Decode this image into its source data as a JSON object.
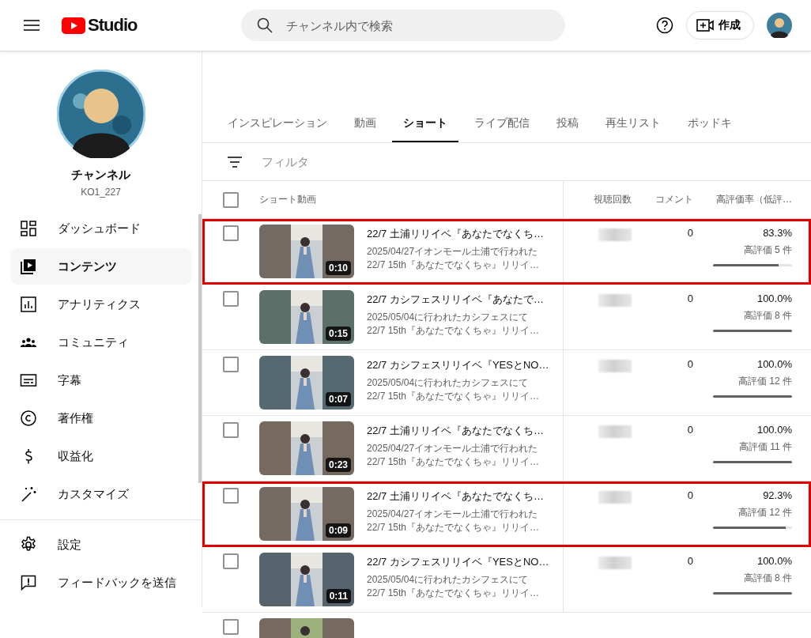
{
  "header": {
    "logo_text": "Studio",
    "search": {
      "placeholder": "チャンネル内で検索"
    },
    "create_button": "作成"
  },
  "channel": {
    "name": "チャンネル",
    "handle": "KO1_227"
  },
  "sidebar": {
    "items": [
      {
        "label": "ダッシュボード",
        "selected": false
      },
      {
        "label": "コンテンツ",
        "selected": true
      },
      {
        "label": "アナリティクス",
        "selected": false
      },
      {
        "label": "コミュニティ",
        "selected": false
      },
      {
        "label": "字幕",
        "selected": false
      },
      {
        "label": "著作権",
        "selected": false
      },
      {
        "label": "収益化",
        "selected": false
      },
      {
        "label": "カスタマイズ",
        "selected": false
      }
    ],
    "footer_items": [
      {
        "label": "設定"
      },
      {
        "label": "フィードバックを送信"
      }
    ]
  },
  "tabs": [
    {
      "label": "インスピレーション",
      "selected": false
    },
    {
      "label": "動画",
      "selected": false
    },
    {
      "label": "ショート",
      "selected": true
    },
    {
      "label": "ライブ配信",
      "selected": false
    },
    {
      "label": "投稿",
      "selected": false
    },
    {
      "label": "再生リスト",
      "selected": false
    },
    {
      "label": "ポッドキ",
      "selected": false
    }
  ],
  "filter": {
    "placeholder": "フィルタ"
  },
  "table": {
    "select_all_checked": false,
    "columns": [
      "ショート動画",
      "視聴回数",
      "コメント",
      "高評価率（低評…"
    ],
    "rows": [
      {
        "checked": false,
        "highlighted": true,
        "duration": "0:10",
        "title": "22/7 土浦リリイベ『あなたでなくち…",
        "desc1": "2025/04/27イオンモール土浦で行われた",
        "desc2": "22/7 15th『あなたでなくちゃ』リリイ…",
        "comments": "0",
        "like_rate": "83.3%",
        "likes": "高評価 5 件",
        "level": 0.833
      },
      {
        "checked": false,
        "highlighted": false,
        "duration": "0:15",
        "title": "22/7 カシフェスリリイベ『あなたで…",
        "desc1": "2025/05/04に行われたカシフェスにて",
        "desc2": "22/7 15th『あなたでなくちゃ』リリイ…",
        "comments": "0",
        "like_rate": "100.0%",
        "likes": "高評価 8 件",
        "level": 1
      },
      {
        "checked": false,
        "highlighted": false,
        "duration": "0:07",
        "title": "22/7 カシフェスリリイベ『YESとNO…",
        "desc1": "2025/05/04に行われたカシフェスにて",
        "desc2": "22/7 15th『あなたでなくちゃ』リリイ…",
        "comments": "0",
        "like_rate": "100.0%",
        "likes": "高評価 12 件",
        "level": 1
      },
      {
        "checked": false,
        "highlighted": false,
        "duration": "0:23",
        "title": "22/7 土浦リリイベ『あなたでなくち…",
        "desc1": "2025/04/27イオンモール土浦で行われた",
        "desc2": "22/7 15th『あなたでなくちゃ』リリイ…",
        "comments": "0",
        "like_rate": "100.0%",
        "likes": "高評価 11 件",
        "level": 1
      },
      {
        "checked": false,
        "highlighted": true,
        "duration": "0:09",
        "title": "22/7 土浦リリイベ『あなたでなくち…",
        "desc1": "2025/04/27イオンモール土浦で行われた",
        "desc2": "22/7 15th『あなたでなくちゃ』リリイ…",
        "comments": "0",
        "like_rate": "92.3%",
        "likes": "高評価 12 件",
        "level": 0.923
      },
      {
        "checked": false,
        "highlighted": false,
        "duration": "0:11",
        "title": "22/7 カシフェスリリイベ『YESとNO…",
        "desc1": "2025/05/04に行われたカシフェスにて",
        "desc2": "22/7 15th『あなたでなくちゃ』リリイ…",
        "comments": "0",
        "like_rate": "100.0%",
        "likes": "高評価 8 件",
        "level": 1
      }
    ],
    "partial_row": {
      "checked": false
    }
  }
}
